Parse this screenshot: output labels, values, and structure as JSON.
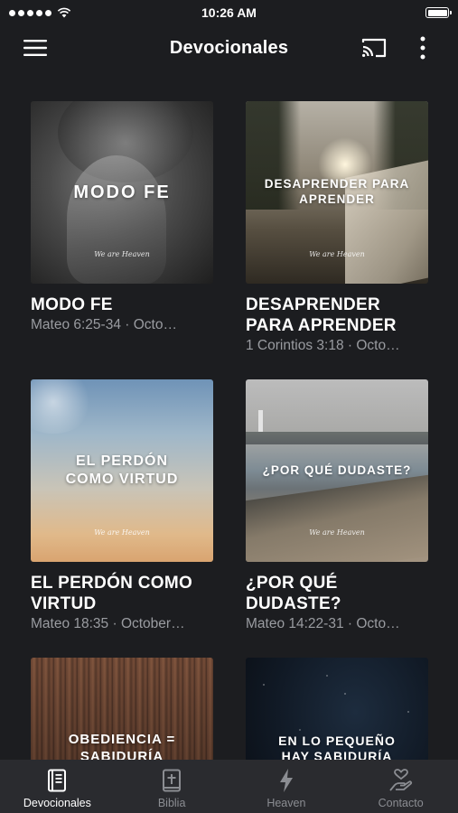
{
  "status_bar": {
    "time": "10:26 AM",
    "signal_icon": "signal-dots-icon",
    "wifi_icon": "wifi-icon",
    "battery_icon": "battery-icon"
  },
  "app_bar": {
    "title": "Devocionales",
    "menu_icon": "hamburger-menu-icon",
    "cast_icon": "cast-icon",
    "more_icon": "more-vertical-icon"
  },
  "devotionals": [
    {
      "image_text": "MODO FE",
      "brand": "We are Heaven",
      "title": "MODO FE",
      "subtitle": "Mateo 6:25-34 · Octo…"
    },
    {
      "image_text": "DESAPRENDER PARA APRENDER",
      "brand": "We are Heaven",
      "title": "DESAPRENDER PARA APRENDER",
      "subtitle": "1 Corintios 3:18 · Octo…"
    },
    {
      "image_text": "EL PERDÓN COMO VIRTUD",
      "brand": "We are Heaven",
      "title": "EL PERDÓN COMO VIRTUD",
      "subtitle": "Mateo 18:35 · October…"
    },
    {
      "image_text": "¿POR QUÉ DUDASTE?",
      "brand": "We are Heaven",
      "title": "¿POR QUÉ DUDASTE?",
      "subtitle": "Mateo 14:22-31 · Octo…"
    },
    {
      "image_text": "OBEDIENCIA = SABIDURÍA"
    },
    {
      "image_text": "EN LO PEQUEÑO HAY SABIDURÍA"
    }
  ],
  "tab_bar": {
    "active": "Devocionales",
    "tabs": [
      {
        "label": "Devocionales",
        "icon": "book-icon"
      },
      {
        "label": "Biblia",
        "icon": "bible-icon"
      },
      {
        "label": "Heaven",
        "icon": "lightning-icon"
      },
      {
        "label": "Contacto",
        "icon": "hand-heart-icon"
      }
    ]
  },
  "colors": {
    "background": "#1c1d20",
    "tab_bar": "#2a2b2f",
    "subtitle": "#9a9ca1",
    "inactive_tab": "#8b8d92",
    "active_tab": "#ffffff"
  }
}
